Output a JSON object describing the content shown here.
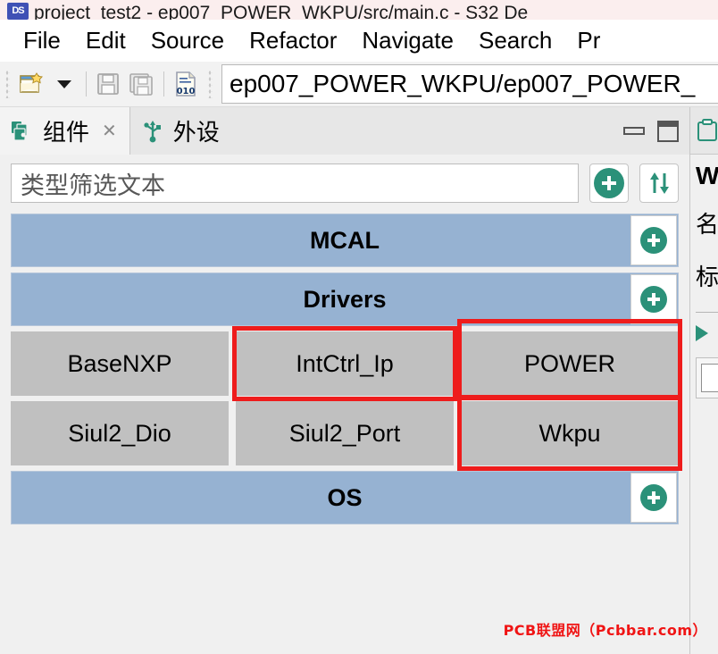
{
  "window": {
    "title": "project_test2 - ep007_POWER_WKPU/src/main.c - S32 De",
    "app_icon": "ide-app-icon"
  },
  "menubar": {
    "items": [
      {
        "label": "File"
      },
      {
        "label": "Edit"
      },
      {
        "label": "Source"
      },
      {
        "label": "Refactor"
      },
      {
        "label": "Navigate"
      },
      {
        "label": "Search"
      },
      {
        "label": "Pr"
      }
    ]
  },
  "toolbar": {
    "new_icon": "new-file-icon",
    "dropdown_icon": "chevron-down-icon",
    "save_icon": "save-icon",
    "save_all_icon": "save-all-icon",
    "hex_icon": "hex-file-icon",
    "path_value": "ep007_POWER_WKPU/ep007_POWER_"
  },
  "view": {
    "tabs": [
      {
        "label": "组件",
        "icon": "components-icon",
        "active": true,
        "closable": true,
        "close_glyph": "✕"
      },
      {
        "label": "外设",
        "icon": "usb-peripheral-icon",
        "active": false,
        "closable": false
      }
    ],
    "minimize_icon": "minimize-icon",
    "maximize_icon": "maximize-icon"
  },
  "filter": {
    "placeholder": "类型筛选文本",
    "value": "类型筛选文本",
    "add_icon": "add-circle-icon",
    "sort_icon": "sort-arrows-icon"
  },
  "tree": {
    "groups": [
      {
        "name": "MCAL",
        "add_icon": "add-circle-icon",
        "rows": []
      },
      {
        "name": "Drivers",
        "add_icon": "add-circle-icon",
        "rows": [
          [
            {
              "label": "BaseNXP",
              "annotated": false
            },
            {
              "label": "IntCtrl_Ip",
              "annotated": true
            },
            {
              "label": "POWER",
              "annotated": true
            }
          ],
          [
            {
              "label": "Siul2_Dio",
              "annotated": false
            },
            {
              "label": "Siul2_Port",
              "annotated": false
            },
            {
              "label": "Wkpu",
              "annotated": true
            }
          ]
        ]
      },
      {
        "name": "OS",
        "add_icon": "add-circle-icon",
        "rows": []
      }
    ]
  },
  "right_panel": {
    "tab_icon": "clipboard-icon",
    "title": "W",
    "lines": [
      "名",
      "标"
    ],
    "arrow_icon": "collapse-arrow-icon"
  },
  "watermark": {
    "text": "PCB联盟网（Pcbbar.com）"
  },
  "colors": {
    "group_header": "#96b2d2",
    "component_tile": "#c0c0c0",
    "accent_green": "#2b9179",
    "annotation_red": "#ee1c1c",
    "watermark_red": "#f01414"
  }
}
